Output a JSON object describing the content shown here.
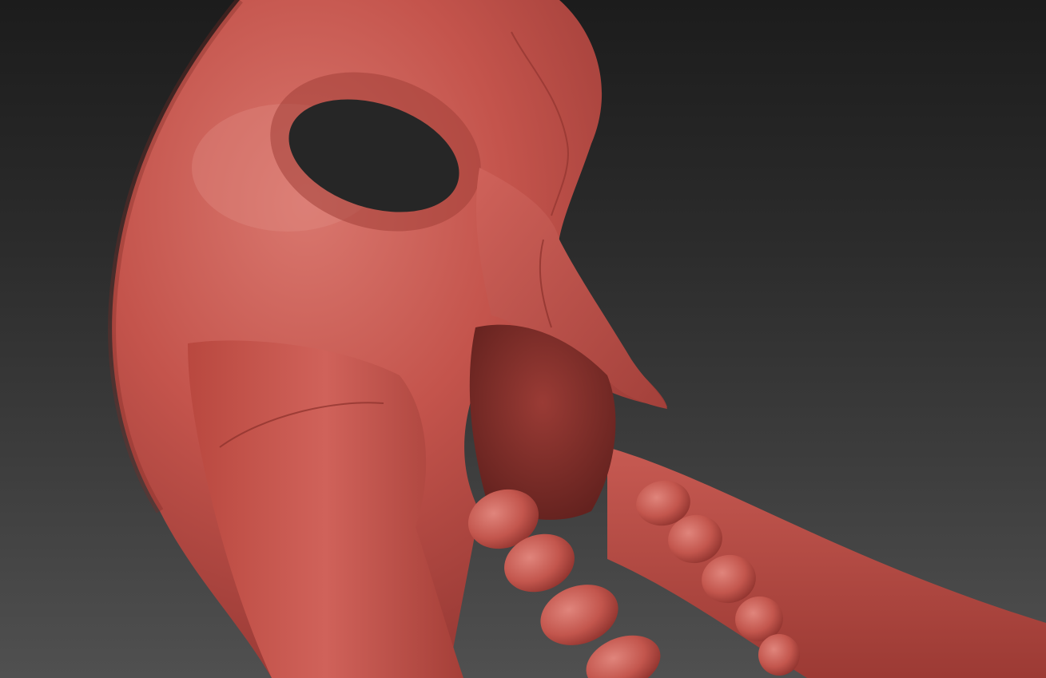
{
  "scene": {
    "subject": "sculpted-mask-model",
    "material_color": "#c4544c",
    "shadow_color": "#7a2a26",
    "highlight_color": "#e08a82",
    "background_top": "#1c1c1c",
    "background_bottom": "#505050"
  }
}
